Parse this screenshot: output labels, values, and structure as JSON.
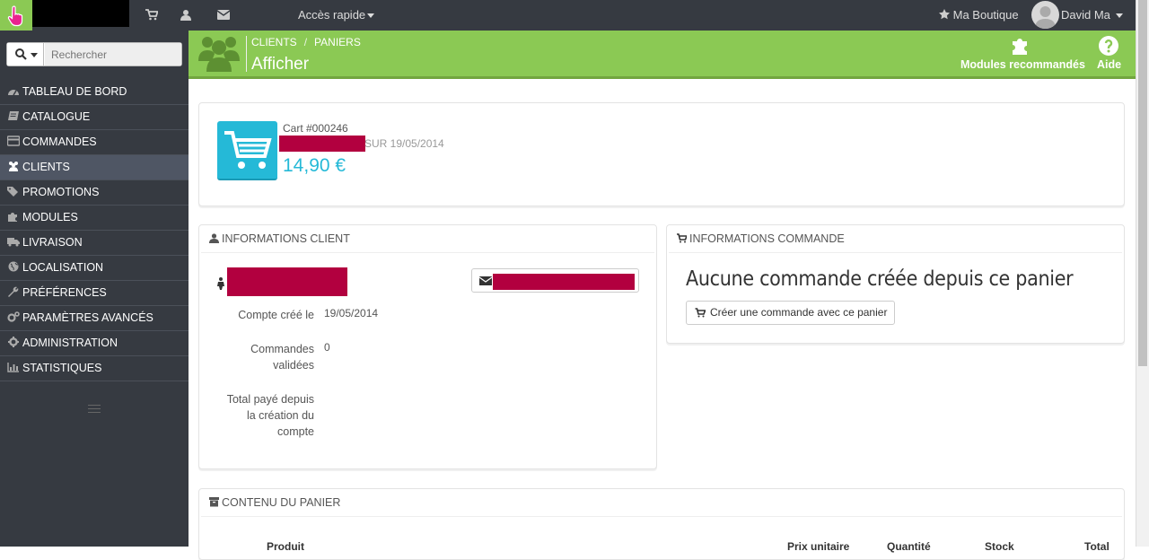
{
  "topbar": {
    "quick_access": "Accès rapide",
    "shop": "Ma Boutique",
    "user": "David Ma"
  },
  "search": {
    "placeholder": "Rechercher"
  },
  "menu": [
    {
      "label": "TABLEAU DE BORD",
      "icon": "dashboard-icon"
    },
    {
      "label": "CATALOGUE",
      "icon": "book-icon"
    },
    {
      "label": "COMMANDES",
      "icon": "credit-card-icon"
    },
    {
      "label": "CLIENTS",
      "icon": "users-icon",
      "active": true
    },
    {
      "label": "PROMOTIONS",
      "icon": "tags-icon"
    },
    {
      "label": "MODULES",
      "icon": "puzzle-icon"
    },
    {
      "label": "LIVRAISON",
      "icon": "truck-icon"
    },
    {
      "label": "LOCALISATION",
      "icon": "globe-icon"
    },
    {
      "label": "PRÉFÉRENCES",
      "icon": "wrench-icon"
    },
    {
      "label": "PARAMÈTRES AVANCÉS",
      "icon": "cogs-icon"
    },
    {
      "label": "ADMINISTRATION",
      "icon": "cog-icon"
    },
    {
      "label": "STATISTIQUES",
      "icon": "bar-chart-icon"
    }
  ],
  "header": {
    "breadcrumb": [
      "CLIENTS",
      "PANIERS"
    ],
    "title": "Afficher",
    "modules_label": "Modules recommandés",
    "help_label": "Aide"
  },
  "cart": {
    "number": "Cart #000246",
    "date_text": "SUR 19/05/2014",
    "amount": "14,90 €"
  },
  "client_panel": {
    "title": "INFORMATIONS CLIENT",
    "account_created_label": "Compte créé le",
    "account_created_value": "19/05/2014",
    "orders_label": "Commandes validées",
    "orders_value": "0",
    "total_label": "Total payé depuis la création du compte"
  },
  "order_panel": {
    "title": "INFORMATIONS COMMANDE",
    "message": "Aucune commande créée depuis ce panier",
    "create_button": "Créer une commande avec ce panier"
  },
  "cart_content": {
    "title": "CONTENU DU PANIER",
    "columns": [
      "Produit",
      "Prix unitaire",
      "Quantité",
      "Stock",
      "Total"
    ]
  },
  "colors": {
    "header_green": "#8bc954",
    "sidebar_dark": "#363a41",
    "accent_blue": "#25b9d7",
    "redaction": "#b2003f"
  }
}
